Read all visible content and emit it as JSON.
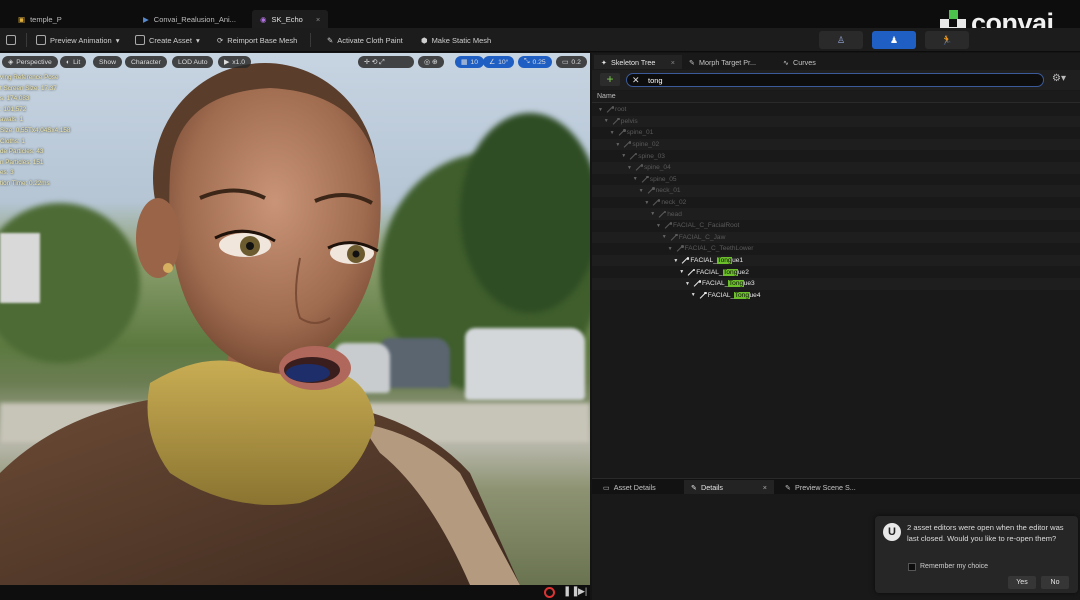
{
  "window": {
    "tabs": [
      {
        "label": "temple_P",
        "icon": "level-icon"
      },
      {
        "label": "Convai_Realusion_Ani...",
        "icon": "anim-icon"
      },
      {
        "label": "SK_Echo",
        "icon": "skeleton-icon"
      }
    ],
    "close_symbol": "×"
  },
  "logo": {
    "text": "convai"
  },
  "toolbar": {
    "preview_animation": "Preview Animation",
    "create_asset": "Create Asset",
    "reimport_base_mesh": "Reimport Base Mesh",
    "activate_cloth_paint": "Activate Cloth Paint",
    "make_static_mesh": "Make Static Mesh"
  },
  "viewport": {
    "perspective": "Perspective",
    "lit": "Lit",
    "show": "Show",
    "character": "Character",
    "lod": "LOD Auto",
    "speed": "x1.0",
    "grid_value": "10",
    "angle_value": "10°",
    "scale_value": "0.25",
    "camera_value": "0.2",
    "stats": [
      "ving Reference Pose",
      "t Screen Size: 17.37",
      "s: 174,083",
      ": 101,572",
      "awals: 1",
      "Size: 0,55Tx4,04Sx4,158",
      "Cloths: 1",
      "de Particles: 43",
      "n Particles: 151",
      "es: 3",
      "tion Time: 0.22ms"
    ]
  },
  "skeleton_panel": {
    "tabs": [
      "Skeleton Tree",
      "Morph Target Pr...",
      "Curves"
    ],
    "search_value": "tong",
    "clear_symbol": "✕",
    "column_name": "Name",
    "tree": [
      {
        "pre": "root",
        "match": "",
        "post": "",
        "depth": 0,
        "hi": false
      },
      {
        "pre": "pelvis",
        "match": "",
        "post": "",
        "depth": 1,
        "hi": false
      },
      {
        "pre": "spine_01",
        "match": "",
        "post": "",
        "depth": 2,
        "hi": false
      },
      {
        "pre": "spine_02",
        "match": "",
        "post": "",
        "depth": 3,
        "hi": false
      },
      {
        "pre": "spine_03",
        "match": "",
        "post": "",
        "depth": 4,
        "hi": false
      },
      {
        "pre": "spine_04",
        "match": "",
        "post": "",
        "depth": 5,
        "hi": false
      },
      {
        "pre": "spine_05",
        "match": "",
        "post": "",
        "depth": 6,
        "hi": false
      },
      {
        "pre": "neck_01",
        "match": "",
        "post": "",
        "depth": 7,
        "hi": false
      },
      {
        "pre": "neck_02",
        "match": "",
        "post": "",
        "depth": 8,
        "hi": false
      },
      {
        "pre": "head",
        "match": "",
        "post": "",
        "depth": 9,
        "hi": false
      },
      {
        "pre": "FACIAL_C_FacialRoot",
        "match": "",
        "post": "",
        "depth": 10,
        "hi": false
      },
      {
        "pre": "FACIAL_C_Jaw",
        "match": "",
        "post": "",
        "depth": 11,
        "hi": false
      },
      {
        "pre": "FACIAL_C_TeethLower",
        "match": "",
        "post": "",
        "depth": 12,
        "hi": false
      },
      {
        "pre": "FACIAL_",
        "match": "Tong",
        "post": "ue1",
        "depth": 13,
        "hi": true
      },
      {
        "pre": "FACIAL_",
        "match": "Tong",
        "post": "ue2",
        "depth": 14,
        "hi": true
      },
      {
        "pre": "FACIAL_",
        "match": "Tong",
        "post": "ue3",
        "depth": 15,
        "hi": true
      },
      {
        "pre": "FACIAL_",
        "match": "Tong",
        "post": "ue4",
        "depth": 16,
        "hi": true
      }
    ]
  },
  "details_panel": {
    "tabs": [
      "Asset Details",
      "Details",
      "Preview Scene S..."
    ]
  },
  "notification": {
    "message": "2 asset editors were open when the editor was last closed. Would you like to re-open them?",
    "remember": "Remember my choice",
    "yes": "Yes",
    "no": "No"
  },
  "colors": {
    "accent_blue": "#1f5fc4",
    "match_green": "#6bbf2a"
  }
}
